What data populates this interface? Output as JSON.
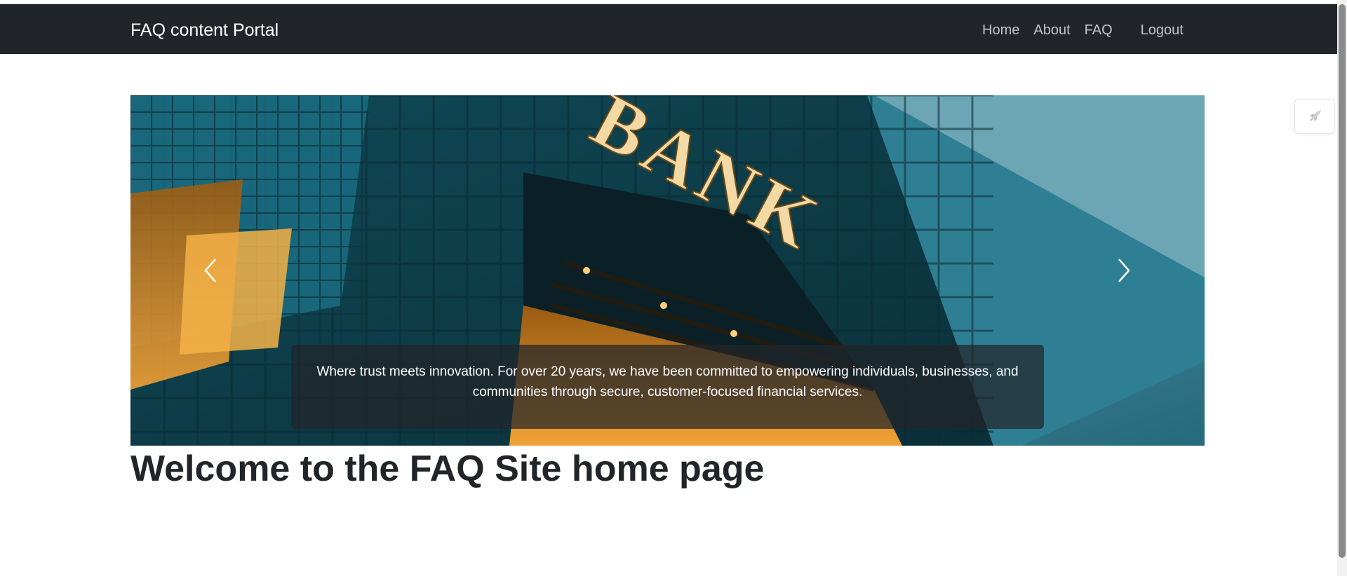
{
  "navbar": {
    "brand": "FAQ content Portal",
    "links": {
      "home": "Home",
      "about": "About",
      "faq": "FAQ",
      "logout": "Logout"
    },
    "background": "#212529"
  },
  "carousel": {
    "sign_text": "BANK",
    "caption": "Where trust meets innovation. For over 20 years, we have been committed to empowering individuals, businesses, and communities through secure, customer-focused financial services.",
    "prev_icon": "chevron-left-icon",
    "next_icon": "chevron-right-icon"
  },
  "main": {
    "title": "Welcome to the FAQ Site home page"
  },
  "floating_tool": {
    "icon": "rocket-icon"
  }
}
